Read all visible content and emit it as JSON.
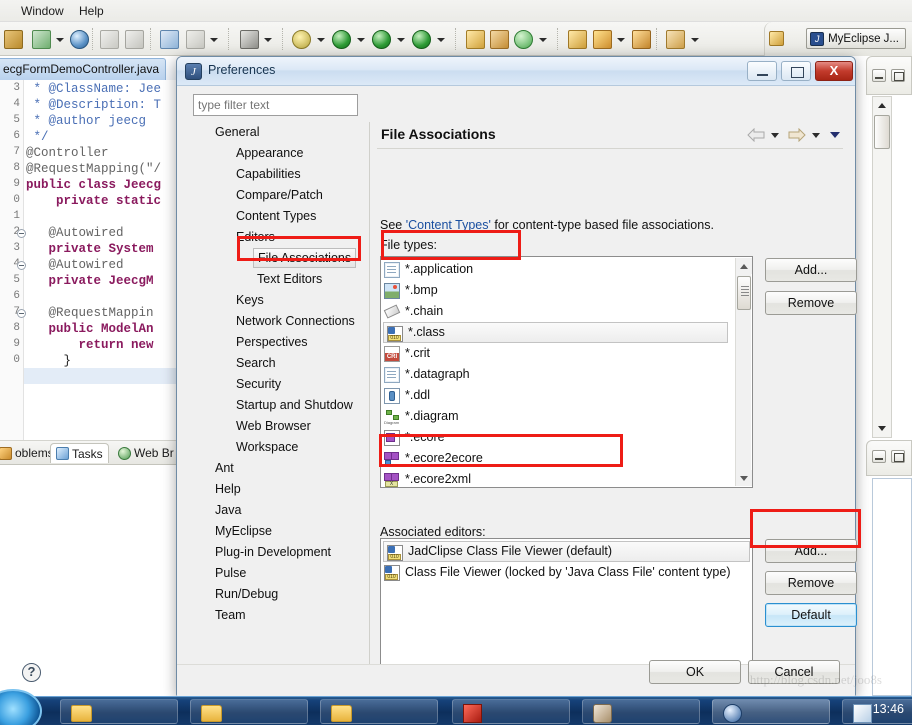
{
  "ide": {
    "menus": [
      "Window",
      "Help"
    ],
    "perspective": {
      "label": "MyEclipse J...",
      "icon": "myeclipse-icon"
    },
    "editor_tab": {
      "label": "ecgFormDemoController.java"
    },
    "bottom_tabs": [
      {
        "label": "oblems",
        "icon": "problems-icon",
        "active": false
      },
      {
        "label": "Tasks",
        "icon": "tasks-icon",
        "active": true
      },
      {
        "label": "Web Br",
        "icon": "web-browser-icon",
        "active": false
      }
    ],
    "code_lines": [
      {
        "num": "3",
        "text": " * @ClassName: Jee",
        "style": "comment",
        "fold": false
      },
      {
        "num": "4",
        "text": " * @Description: T",
        "style": "comment",
        "fold": false
      },
      {
        "num": "5",
        "text": " * @author jeecg",
        "style": "comment",
        "fold": false
      },
      {
        "num": "6",
        "text": " */",
        "style": "comment",
        "fold": false
      },
      {
        "num": "7",
        "text": "@Controller",
        "style": "annotation",
        "fold": false
      },
      {
        "num": "8",
        "text": "@RequestMapping(\"/",
        "style": "annotation",
        "fold": false
      },
      {
        "num": "9",
        "text": "public class Jeecg",
        "style": "keyword",
        "fold": false
      },
      {
        "num": "0",
        "text": "    private static",
        "style": "keyword",
        "fold": false
      },
      {
        "num": "1",
        "text": "",
        "style": "plain",
        "fold": false
      },
      {
        "num": "2",
        "text": "   @Autowired",
        "style": "annotation",
        "fold": true
      },
      {
        "num": "3",
        "text": "   private System",
        "style": "keyword",
        "fold": false
      },
      {
        "num": "4",
        "text": "   @Autowired",
        "style": "annotation",
        "fold": true
      },
      {
        "num": "5",
        "text": "   private JeecgM",
        "style": "keyword",
        "fold": false
      },
      {
        "num": "6",
        "text": "",
        "style": "plain",
        "fold": false
      },
      {
        "num": "7",
        "text": "   @RequestMappin",
        "style": "annotation",
        "fold": true
      },
      {
        "num": "8",
        "text": "   public ModelAn",
        "style": "keyword",
        "fold": false
      },
      {
        "num": "9",
        "text": "       return new",
        "style": "keyword",
        "fold": false
      },
      {
        "num": "0",
        "text": "     }",
        "style": "plain",
        "fold": false
      }
    ]
  },
  "dialog": {
    "title": "Preferences",
    "title_icon": "myeclipse-icon",
    "window_buttons": {
      "minimize": "minimize-icon",
      "maximize": "maximize-icon",
      "close": "X"
    },
    "filter": {
      "placeholder": "type filter text",
      "value": ""
    },
    "tree": [
      {
        "label": "General",
        "indent": 0,
        "selected": false
      },
      {
        "label": "Appearance",
        "indent": 1,
        "selected": false
      },
      {
        "label": "Capabilities",
        "indent": 1,
        "selected": false
      },
      {
        "label": "Compare/Patch",
        "indent": 1,
        "selected": false
      },
      {
        "label": "Content Types",
        "indent": 1,
        "selected": false
      },
      {
        "label": "Editors",
        "indent": 1,
        "selected": false
      },
      {
        "label": "File Associations",
        "indent": 2,
        "selected": true
      },
      {
        "label": "Text Editors",
        "indent": 2,
        "selected": false
      },
      {
        "label": "Keys",
        "indent": 1,
        "selected": false
      },
      {
        "label": "Network Connections",
        "indent": 1,
        "selected": false
      },
      {
        "label": "Perspectives",
        "indent": 1,
        "selected": false
      },
      {
        "label": "Search",
        "indent": 1,
        "selected": false
      },
      {
        "label": "Security",
        "indent": 1,
        "selected": false
      },
      {
        "label": "Startup and Shutdow",
        "indent": 1,
        "selected": false
      },
      {
        "label": "Web Browser",
        "indent": 1,
        "selected": false
      },
      {
        "label": "Workspace",
        "indent": 1,
        "selected": false
      },
      {
        "label": "Ant",
        "indent": 0,
        "selected": false
      },
      {
        "label": "Help",
        "indent": 0,
        "selected": false
      },
      {
        "label": "Java",
        "indent": 0,
        "selected": false
      },
      {
        "label": "MyEclipse",
        "indent": 0,
        "selected": false
      },
      {
        "label": "Plug-in Development",
        "indent": 0,
        "selected": false
      },
      {
        "label": "Pulse",
        "indent": 0,
        "selected": false
      },
      {
        "label": "Run/Debug",
        "indent": 0,
        "selected": false
      },
      {
        "label": "Team",
        "indent": 0,
        "selected": false
      }
    ],
    "pane": {
      "title": "File Associations",
      "description_prefix": "See ",
      "description_link": "'Content Types'",
      "description_suffix": " for content-type based file associations.",
      "file_types_label": "File types:",
      "associated_editors_label": "Associated editors:"
    },
    "file_types": [
      {
        "label": "*.application",
        "icon": "file-icon",
        "selected": false
      },
      {
        "label": "*.bmp",
        "icon": "image-icon",
        "selected": false
      },
      {
        "label": "*.chain",
        "icon": "chain-icon",
        "selected": false
      },
      {
        "label": "*.class",
        "icon": "class-file-icon",
        "selected": true
      },
      {
        "label": "*.crit",
        "icon": "crit-icon",
        "selected": false
      },
      {
        "label": "*.datagraph",
        "icon": "file-icon",
        "selected": false
      },
      {
        "label": "*.ddl",
        "icon": "ddl-icon",
        "selected": false
      },
      {
        "label": "*.diagram",
        "icon": "diagram-icon",
        "selected": false
      },
      {
        "label": "*.ecore",
        "icon": "ecore-icon",
        "selected": false
      },
      {
        "label": "*.ecore2ecore",
        "icon": "ecore2ecore-icon",
        "selected": false
      },
      {
        "label": "*.ecore2xml",
        "icon": "ecore2xml-icon",
        "selected": false
      }
    ],
    "file_type_buttons": [
      {
        "label": "Add...",
        "name": "filetypes-add-button"
      },
      {
        "label": "Remove",
        "name": "filetypes-remove-button"
      }
    ],
    "associated_editors": [
      {
        "label": "JadClipse Class File Viewer (default)",
        "icon": "class-file-icon",
        "selected": true
      },
      {
        "label": "Class File Viewer (locked by 'Java Class File' content type)",
        "icon": "class-file-icon",
        "selected": false
      }
    ],
    "editor_buttons": [
      {
        "label": "Add...",
        "name": "editors-add-button",
        "focus": false
      },
      {
        "label": "Remove",
        "name": "editors-remove-button",
        "focus": false
      },
      {
        "label": "Default",
        "name": "editors-default-button",
        "focus": true
      }
    ],
    "footer": {
      "help": "?",
      "ok": "OK",
      "cancel": "Cancel"
    }
  },
  "taskbar": {
    "clock": "13:46"
  },
  "watermark": {
    "text": "http://blog.csdn.net/joo8s"
  },
  "colors": {
    "accent_red": "#ee1c16",
    "link_blue": "#1a4fa0",
    "focus_blue": "#2a8fd0",
    "title_blue": "#16334f"
  }
}
